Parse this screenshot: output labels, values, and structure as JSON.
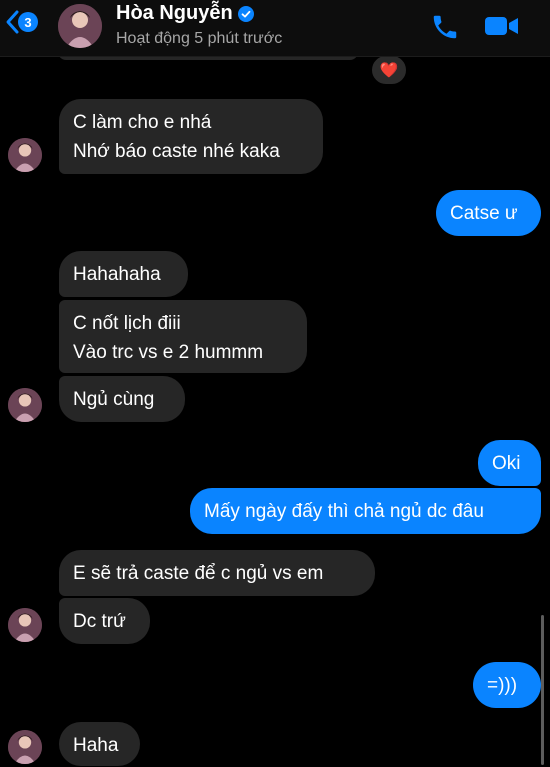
{
  "header": {
    "back_count": "3",
    "contact_name": "Hòa Nguyễn",
    "status": "Hoạt động 5 phút trước"
  },
  "reaction": "❤️",
  "messages": [
    {
      "lines": [
        "C làm cho e nhá",
        "Nhớ báo caste nhé kaka"
      ]
    },
    {
      "lines": [
        "Catse ư"
      ]
    },
    {
      "lines": [
        "Hahahaha"
      ]
    },
    {
      "lines": [
        "C nốt lịch điii",
        "Vào trc vs e 2 hummm"
      ]
    },
    {
      "lines": [
        "Ngủ cùng"
      ]
    },
    {
      "lines": [
        "Oki"
      ]
    },
    {
      "lines": [
        "Mấy ngày đấy thì chả ngủ dc đâu"
      ]
    },
    {
      "lines": [
        "E sẽ trả caste để c ngủ vs em"
      ]
    },
    {
      "lines": [
        "Dc trứ"
      ]
    },
    {
      "lines": [
        "=)))"
      ]
    },
    {
      "lines": [
        "Haha"
      ]
    }
  ]
}
